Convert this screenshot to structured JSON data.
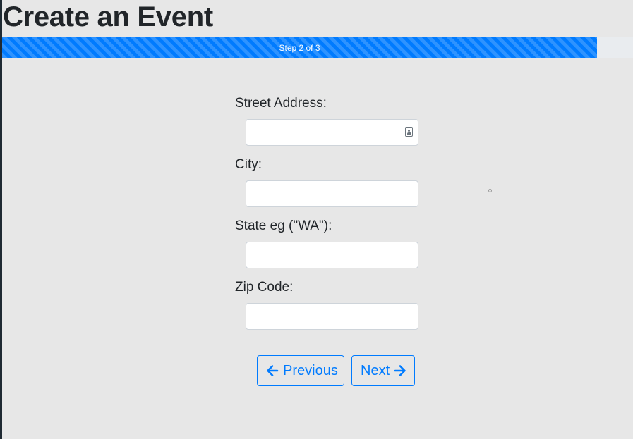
{
  "page": {
    "title": "Create an Event"
  },
  "progress": {
    "label": "Step 2 of 3",
    "fraction": 0.943,
    "color": "#007bff"
  },
  "form": {
    "fields": [
      {
        "label": "Street Address:",
        "value": "",
        "placeholder": ""
      },
      {
        "label": "City:",
        "value": "",
        "placeholder": ""
      },
      {
        "label": "State eg (\"WA\"):",
        "value": "",
        "placeholder": ""
      },
      {
        "label": "Zip Code:",
        "value": "",
        "placeholder": ""
      }
    ]
  },
  "buttons": {
    "previous_label": "Previous",
    "previous_icon": "arrow-left-icon",
    "next_label": "Next",
    "next_icon": "arrow-right-icon"
  }
}
